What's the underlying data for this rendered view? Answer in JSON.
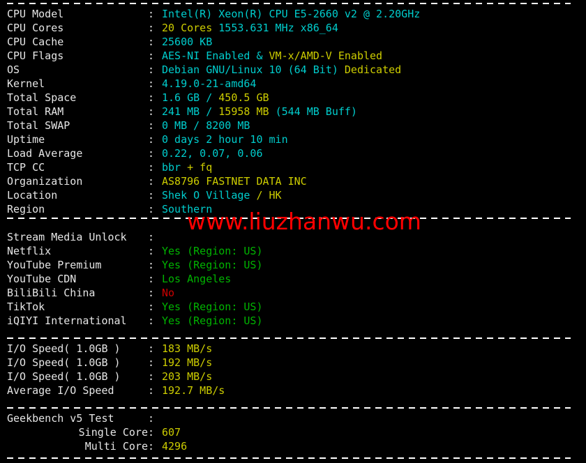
{
  "terminal": {
    "background": "#000000",
    "foreground": "#e6e6e6",
    "colors": {
      "cyan": "#00cdcd",
      "yellow": "#cdcd00",
      "green": "#00b400",
      "red": "#cd0000",
      "white": "#e6e6e6"
    },
    "separator_char": "-"
  },
  "watermark": {
    "text": "www.liuzhanwu.com",
    "color": "#ff0000"
  },
  "system_info": {
    "rows": [
      {
        "label": "CPU Model",
        "colon": ":",
        "segments": [
          {
            "text": "Intel(R) Xeon(R) CPU E5-2660 v2 @ 2.20GHz",
            "color": "cyan"
          }
        ]
      },
      {
        "label": "CPU Cores",
        "colon": ":",
        "segments": [
          {
            "text": "20 Cores ",
            "color": "yellow"
          },
          {
            "text": "1553.631 MHz x86_64",
            "color": "cyan"
          }
        ]
      },
      {
        "label": "CPU Cache",
        "colon": ":",
        "segments": [
          {
            "text": "25600 KB",
            "color": "cyan"
          }
        ]
      },
      {
        "label": "CPU Flags",
        "colon": ":",
        "segments": [
          {
            "text": "AES-NI Enabled & ",
            "color": "cyan"
          },
          {
            "text": "VM-x/AMD-V Enabled",
            "color": "yellow"
          }
        ]
      },
      {
        "label": "OS",
        "colon": ":",
        "segments": [
          {
            "text": "Debian GNU/Linux 10 (64 Bit) ",
            "color": "cyan"
          },
          {
            "text": "Dedicated",
            "color": "yellow"
          }
        ]
      },
      {
        "label": "Kernel",
        "colon": ":",
        "segments": [
          {
            "text": "4.19.0-21-amd64",
            "color": "cyan"
          }
        ]
      },
      {
        "label": "Total Space",
        "colon": ":",
        "segments": [
          {
            "text": "1.6 GB / ",
            "color": "cyan"
          },
          {
            "text": "450.5 GB",
            "color": "yellow"
          }
        ]
      },
      {
        "label": "Total RAM",
        "colon": ":",
        "segments": [
          {
            "text": "241 MB / ",
            "color": "cyan"
          },
          {
            "text": "15958 MB ",
            "color": "yellow"
          },
          {
            "text": "(544 MB Buff)",
            "color": "cyan"
          }
        ]
      },
      {
        "label": "Total SWAP",
        "colon": ":",
        "segments": [
          {
            "text": "0 MB / 8200 MB",
            "color": "cyan"
          }
        ]
      },
      {
        "label": "Uptime",
        "colon": ":",
        "segments": [
          {
            "text": "0 days 2 hour 10 min",
            "color": "cyan"
          }
        ]
      },
      {
        "label": "Load Average",
        "colon": ":",
        "segments": [
          {
            "text": "0.22, 0.07, 0.06",
            "color": "cyan"
          }
        ]
      },
      {
        "label": "TCP CC",
        "colon": ":",
        "segments": [
          {
            "text": "bbr ",
            "color": "cyan"
          },
          {
            "text": "+ fq",
            "color": "yellow"
          }
        ]
      },
      {
        "label": "Organization",
        "colon": ":",
        "segments": [
          {
            "text": "AS8796 FASTNET DATA INC",
            "color": "yellow"
          }
        ]
      },
      {
        "label": "Location",
        "colon": ":",
        "segments": [
          {
            "text": "Shek O Village ",
            "color": "cyan"
          },
          {
            "text": "/ HK",
            "color": "yellow"
          }
        ]
      },
      {
        "label": "Region",
        "colon": ":",
        "segments": [
          {
            "text": "Southern",
            "color": "cyan"
          }
        ]
      }
    ]
  },
  "stream_media": {
    "rows": [
      {
        "label": "Stream Media Unlock",
        "colon": ":",
        "segments": []
      },
      {
        "label": "Netflix",
        "colon": ":",
        "segments": [
          {
            "text": "Yes (Region: US)",
            "color": "green"
          }
        ]
      },
      {
        "label": "YouTube Premium",
        "colon": ":",
        "segments": [
          {
            "text": "Yes (Region: US)",
            "color": "green"
          }
        ]
      },
      {
        "label": "YouTube CDN",
        "colon": ":",
        "segments": [
          {
            "text": "Los Angeles",
            "color": "green"
          }
        ]
      },
      {
        "label": "BiliBili China",
        "colon": ":",
        "segments": [
          {
            "text": "No",
            "color": "red"
          }
        ]
      },
      {
        "label": "TikTok",
        "colon": ":",
        "segments": [
          {
            "text": "Yes (Region: US)",
            "color": "green"
          }
        ]
      },
      {
        "label": "iQIYI International",
        "colon": ":",
        "segments": [
          {
            "text": "Yes (Region: US)",
            "color": "green"
          }
        ]
      }
    ]
  },
  "io_speed": {
    "rows": [
      {
        "label": "I/O Speed( 1.0GB )",
        "colon": ":",
        "segments": [
          {
            "text": "183 MB/s",
            "color": "yellow"
          }
        ]
      },
      {
        "label": "I/O Speed( 1.0GB )",
        "colon": ":",
        "segments": [
          {
            "text": "192 MB/s",
            "color": "yellow"
          }
        ]
      },
      {
        "label": "I/O Speed( 1.0GB )",
        "colon": ":",
        "segments": [
          {
            "text": "203 MB/s",
            "color": "yellow"
          }
        ]
      },
      {
        "label": "Average I/O Speed",
        "colon": ":",
        "segments": [
          {
            "text": "192.7 MB/s",
            "color": "yellow"
          }
        ]
      }
    ]
  },
  "geekbench": {
    "rows": [
      {
        "label": "Geekbench v5 Test",
        "colon": ":",
        "indent": false,
        "segments": []
      },
      {
        "label": "Single Core",
        "colon": ":",
        "indent": true,
        "segments": [
          {
            "text": "607",
            "color": "yellow"
          }
        ]
      },
      {
        "label": "Multi Core",
        "colon": ":",
        "indent": true,
        "segments": [
          {
            "text": "4296",
            "color": "yellow"
          }
        ]
      }
    ]
  }
}
